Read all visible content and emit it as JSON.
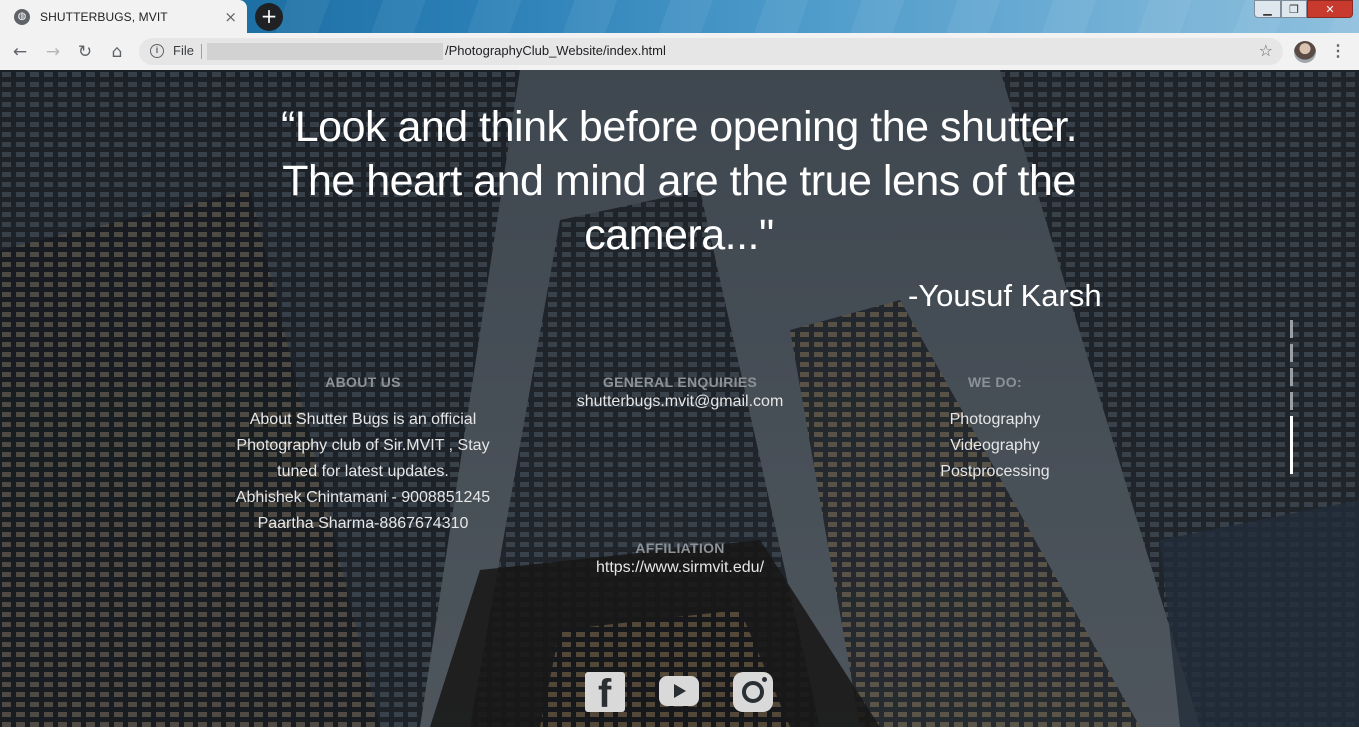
{
  "browser": {
    "tab_title": "SHUTTERBUGS, MVIT",
    "tab_close": "×",
    "new_tab": "+",
    "window_controls": {
      "minimize": "▁",
      "maximize": "❐",
      "close": "✕"
    },
    "nav": {
      "back": "←",
      "forward": "→",
      "reload": "↻",
      "home": "⌂"
    },
    "address": {
      "info_glyph": "i",
      "scheme_label": "File",
      "url": "/PhotographyClub_Website/index.html"
    },
    "star": "☆",
    "menu": "⋮"
  },
  "page": {
    "quote": "“Look and think before opening the shutter. The heart and mind are the true lens of the camera...\"",
    "author": "-Yousuf Karsh",
    "about": {
      "heading": "ABOUT US",
      "lines": [
        "About Shutter Bugs is an official",
        "Photography club of Sir.MVIT , Stay",
        "tuned for latest updates.",
        "Abhishek Chintamani - 9008851245",
        "Paartha Sharma-8867674310"
      ]
    },
    "enquiries": {
      "heading": "GENERAL ENQUIRIES",
      "email": "shutterbugs.mvit@gmail.com"
    },
    "we_do": {
      "heading": "WE DO:",
      "items": [
        "Photography",
        "Videography",
        "Postprocessing"
      ]
    },
    "affiliation": {
      "heading": "AFFILIATION",
      "url": "https://www.sirmvit.edu/"
    },
    "social": {
      "facebook": "f"
    },
    "pager": {
      "total": 5,
      "active": 5
    }
  },
  "colors": {
    "text": "#ffffff",
    "heading_muted": "#8c9298",
    "tab_strip": "#2a7fb6",
    "close_button": "#c8392e"
  }
}
